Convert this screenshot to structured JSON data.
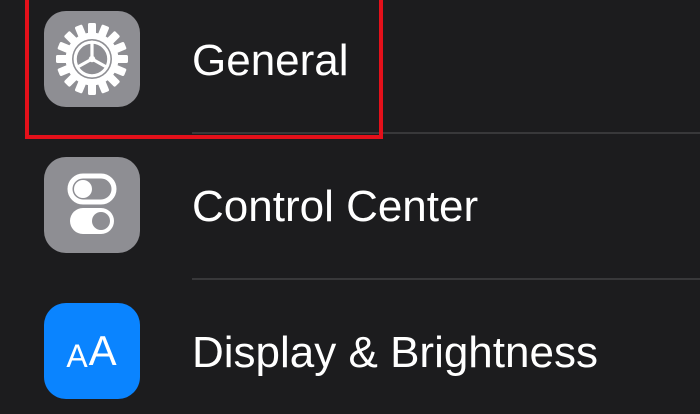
{
  "colors": {
    "background": "#1c1c1e",
    "separator": "#38383a",
    "gray_tile": "#8e8e93",
    "blue_tile": "#0a84ff",
    "highlight": "#e4101a"
  },
  "settings": {
    "items": [
      {
        "label": "General",
        "icon": "gear-icon"
      },
      {
        "label": "Control Center",
        "icon": "toggles-icon"
      },
      {
        "label": "Display & Brightness",
        "icon": "text-size-icon",
        "icon_small": "A",
        "icon_big": "A"
      }
    ]
  }
}
